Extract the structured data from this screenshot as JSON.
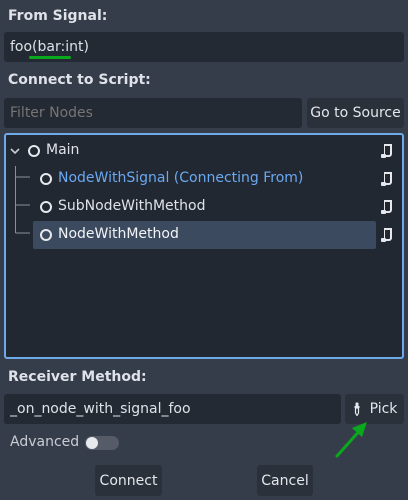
{
  "signal": {
    "heading": "From Signal:",
    "value": "foo(bar:int)",
    "underline_color": "#0aa81c"
  },
  "script": {
    "heading": "Connect to Script:",
    "filter_placeholder": "Filter Nodes",
    "go_to_source_label": "Go to Source"
  },
  "tree": {
    "items": [
      {
        "label": "Main",
        "level": 0,
        "state": "normal"
      },
      {
        "label": "NodeWithSignal (Connecting From)",
        "level": 1,
        "state": "source"
      },
      {
        "label": "SubNodeWithMethod",
        "level": 1,
        "state": "normal"
      },
      {
        "label": "NodeWithMethod",
        "level": 1,
        "state": "selected"
      }
    ],
    "script_icon": "script-icon"
  },
  "receiver": {
    "heading": "Receiver Method:",
    "value": "_on_node_with_signal_foo",
    "pick_label": "Pick",
    "pick_icon": "pipette-icon"
  },
  "advanced": {
    "label": "Advanced",
    "enabled": false
  },
  "footer": {
    "connect_label": "Connect",
    "cancel_label": "Cancel"
  },
  "colors": {
    "accent": "#6fa9e8",
    "source_text": "#6aa9f2",
    "annotation_arrow": "#0aa81c"
  }
}
